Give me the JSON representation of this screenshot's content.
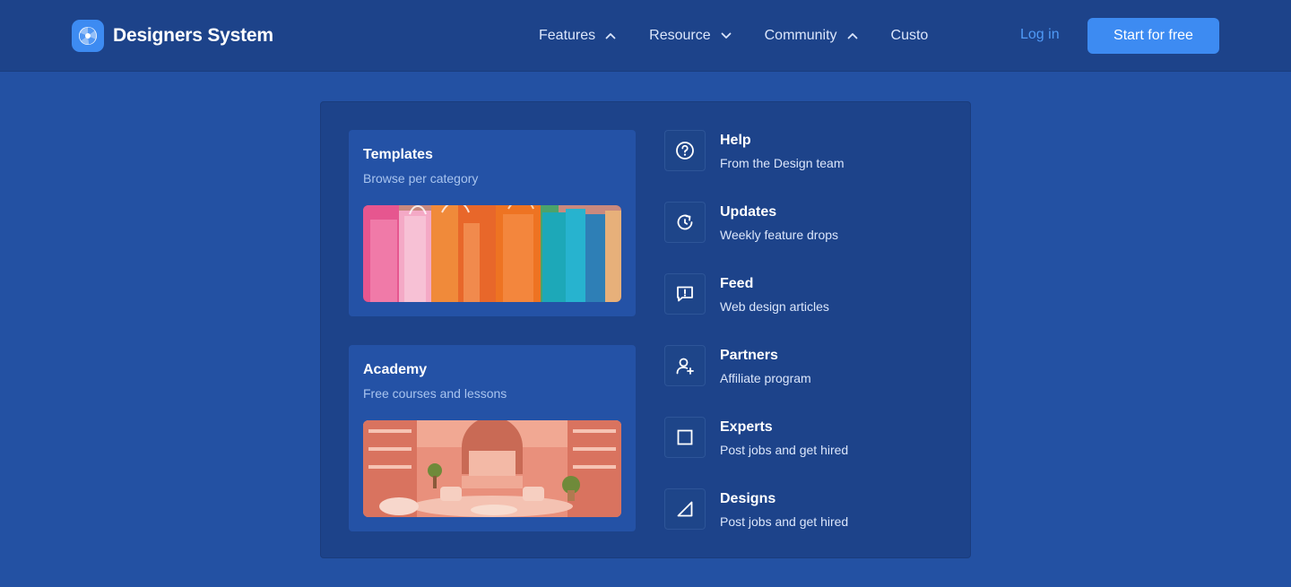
{
  "brand": {
    "name": "Designers System",
    "logo_icon": "aperture-icon",
    "accent": "#3d8bf2"
  },
  "nav": {
    "items": [
      {
        "label": "Features",
        "icon": "chevron-up-icon"
      },
      {
        "label": "Resource",
        "icon": "chevron-down-icon"
      },
      {
        "label": "Community",
        "icon": "chevron-up-icon"
      },
      {
        "label": "Custo"
      }
    ],
    "login": "Log in",
    "cta": "Start for free"
  },
  "dropdown": {
    "cards": [
      {
        "title": "Templates",
        "subtitle": "Browse per category",
        "image": "colorful-shopping-bags-photo"
      },
      {
        "title": "Academy",
        "subtitle": "Free courses and lessons",
        "image": "pink-store-interior-photo"
      }
    ],
    "links": [
      {
        "title": "Help",
        "subtitle": "From the Design team",
        "icon": "question-circle-icon"
      },
      {
        "title": "Updates",
        "subtitle": "Weekly feature drops",
        "icon": "refresh-icon"
      },
      {
        "title": "Feed",
        "subtitle": "Web design articles",
        "icon": "message-alert-icon"
      },
      {
        "title": "Partners",
        "subtitle": "Affiliate program",
        "icon": "user-plus-icon"
      },
      {
        "title": "Experts",
        "subtitle": "Post jobs and get hired",
        "icon": "square-icon"
      },
      {
        "title": "Designs",
        "subtitle": "Post jobs and get hired",
        "icon": "triangle-icon"
      }
    ]
  },
  "colors": {
    "page_bg": "#2351a3",
    "header_bg": "#1d438a",
    "panel_bg": "#1d438a",
    "card_bg": "#2452a6",
    "link_color": "#4f9af7"
  }
}
